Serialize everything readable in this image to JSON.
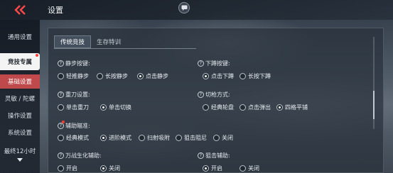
{
  "header": {
    "title": "设置"
  },
  "sidebar": {
    "items": [
      {
        "label": "通用设置"
      },
      {
        "label": "竞技专属"
      },
      {
        "label": "基础设置"
      },
      {
        "label": "灵敏 / 陀螺"
      },
      {
        "label": "操作设置"
      },
      {
        "label": "系统设置"
      },
      {
        "label": "最终12小时"
      }
    ]
  },
  "tabs": [
    {
      "label": "传统竞技"
    },
    {
      "label": "生存特训"
    }
  ],
  "settings": {
    "jump": {
      "label": "静步按键:",
      "options": [
        "轻推静步",
        "长按静步",
        "点击静步"
      ],
      "selected": 2
    },
    "crouch": {
      "label": "下蹲按键:",
      "options": [
        "点击下蹲",
        "长按下蹲"
      ],
      "selected": 0
    },
    "weapon": {
      "label": "重刀设置:",
      "options": [
        "单击重刀",
        "单击切换"
      ],
      "selected": 1
    },
    "switch": {
      "label": "切枪方式:",
      "options": [
        "经典轮盘",
        "点击弹出",
        "四格平铺"
      ],
      "selected": 2
    },
    "aim": {
      "label": "辅助瞄准:",
      "options": [
        "经典模式",
        "进阶模式",
        "扫射吸附",
        "狙击阻尼",
        "关闭"
      ],
      "selected": 1
    },
    "blade": {
      "label": "万战生化辅助:",
      "options": [
        "开启",
        "关闭"
      ],
      "selected": 1
    },
    "snipe": {
      "label": "狙击辅助:",
      "options": [
        "开启",
        "关闭"
      ],
      "selected": 0
    }
  },
  "icons": {
    "back": "double-chevron-left-icon",
    "chat": "chat-bubble-icon",
    "question": "question-mark-icon",
    "dropdown": "caret-down-icon"
  },
  "colors": {
    "accent_red": "#ff3b30",
    "sub_highlight": "#d9534f"
  }
}
